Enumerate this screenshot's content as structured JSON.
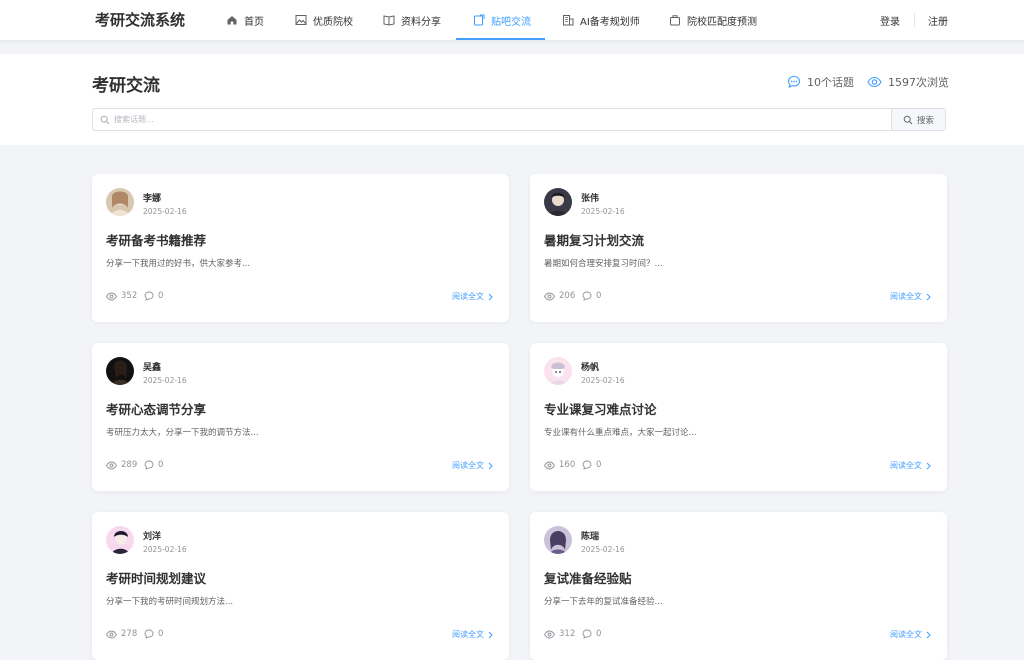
{
  "brand": "考研交流系统",
  "nav": [
    {
      "label": "首页",
      "icon": "home-icon"
    },
    {
      "label": "优质院校",
      "icon": "image-icon"
    },
    {
      "label": "资料分享",
      "icon": "book-icon"
    },
    {
      "label": "贴吧交流",
      "icon": "note-icon",
      "active": true
    },
    {
      "label": "AI备考规划师",
      "icon": "building-icon"
    },
    {
      "label": "院校匹配度预测",
      "icon": "briefcase-icon"
    }
  ],
  "auth": {
    "login": "登录",
    "register": "注册"
  },
  "header": {
    "title": "考研交流",
    "topics": "10个话题",
    "views": "1597次浏览"
  },
  "search": {
    "placeholder": "搜索话题...",
    "button": "搜索"
  },
  "read_more": "阅读全文",
  "posts": [
    {
      "author": "李娜",
      "date": "2025-02-16",
      "title": "考研备考书籍推荐",
      "excerpt": "分享一下我用过的好书，供大家参考...",
      "views": "352",
      "comments": "0"
    },
    {
      "author": "张伟",
      "date": "2025-02-16",
      "title": "暑期复习计划交流",
      "excerpt": "暑期如何合理安排复习时间？...",
      "views": "206",
      "comments": "0"
    },
    {
      "author": "吴鑫",
      "date": "2025-02-16",
      "title": "考研心态调节分享",
      "excerpt": "考研压力太大，分享一下我的调节方法...",
      "views": "289",
      "comments": "0"
    },
    {
      "author": "杨帆",
      "date": "2025-02-16",
      "title": "专业课复习难点讨论",
      "excerpt": "专业课有什么重点难点，大家一起讨论...",
      "views": "160",
      "comments": "0"
    },
    {
      "author": "刘洋",
      "date": "2025-02-16",
      "title": "考研时间规划建议",
      "excerpt": "分享一下我的考研时间规划方法...",
      "views": "278",
      "comments": "0"
    },
    {
      "author": "陈瑞",
      "date": "2025-02-16",
      "title": "复试准备经验贴",
      "excerpt": "分享一下去年的复试准备经验...",
      "views": "312",
      "comments": "0"
    }
  ],
  "colors": {
    "accent": "#409eff",
    "text": "#303133",
    "muted": "#909399",
    "bg": "#f2f4f7"
  }
}
